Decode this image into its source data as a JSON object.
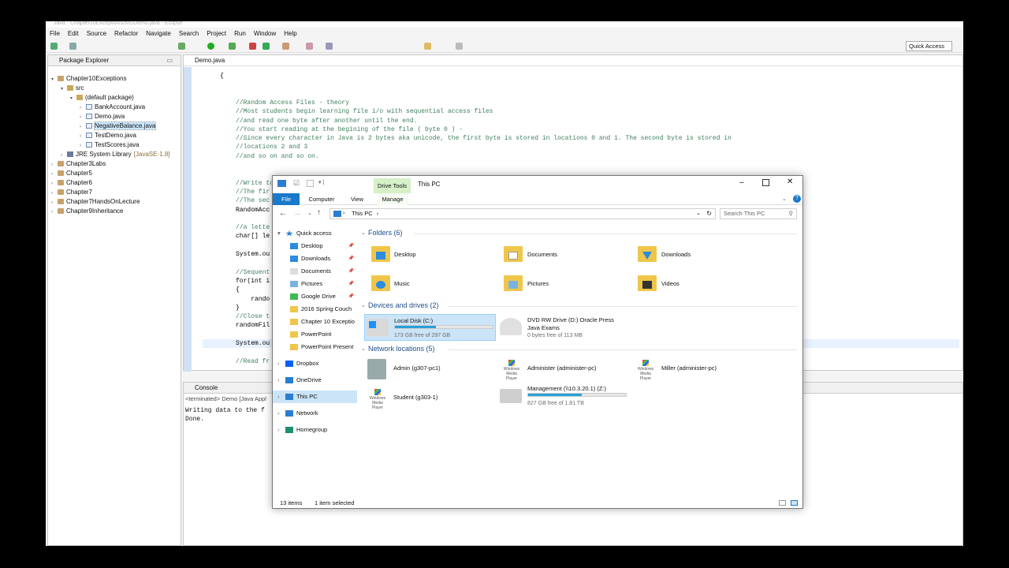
{
  "eclipse": {
    "title": "Java - Chapter10Exceptions/src/Demo.java - Eclipse",
    "menu": [
      "File",
      "Edit",
      "Source",
      "Refactor",
      "Navigate",
      "Search",
      "Project",
      "Run",
      "Window",
      "Help"
    ],
    "quick_access": "Quick Access",
    "package_explorer": {
      "tab": "Package Explorer",
      "items": [
        {
          "label": "Chapter10Exceptions",
          "level": 0,
          "icon": "project-icon",
          "twisty": "▾"
        },
        {
          "label": "src",
          "level": 1,
          "icon": "package-folder-icon",
          "twisty": "▾"
        },
        {
          "label": "(default package)",
          "level": 2,
          "icon": "package-icon",
          "twisty": "▾"
        },
        {
          "label": "BankAccount.java",
          "level": 3,
          "icon": "java-file-icon",
          "twisty": "›"
        },
        {
          "label": "Demo.java",
          "level": 3,
          "icon": "java-file-icon",
          "twisty": "›"
        },
        {
          "label": "NegativeBalance.java",
          "level": 3,
          "icon": "java-file-icon",
          "twisty": "›",
          "selected": true
        },
        {
          "label": "TestDemo.java",
          "level": 3,
          "icon": "java-file-icon",
          "twisty": "›"
        },
        {
          "label": "TestScores.java",
          "level": 3,
          "icon": "java-file-icon",
          "twisty": "›"
        },
        {
          "label": "JRE System Library",
          "extra": "[JavaSE-1.8]",
          "level": 1,
          "icon": "library-icon",
          "twisty": "›"
        },
        {
          "label": "Chapter3Labs",
          "level": 0,
          "icon": "project-icon",
          "twisty": "›"
        },
        {
          "label": "Chapter5",
          "level": 0,
          "icon": "project-icon",
          "twisty": "›"
        },
        {
          "label": "Chapter6",
          "level": 0,
          "icon": "project-icon",
          "twisty": "›"
        },
        {
          "label": "Chapter7",
          "level": 0,
          "icon": "project-icon",
          "twisty": "›"
        },
        {
          "label": "Chapter7HandsOnLecture",
          "level": 0,
          "icon": "project-icon",
          "twisty": "›"
        },
        {
          "label": "Chapter9Inheritance",
          "level": 0,
          "icon": "project-icon",
          "twisty": "›"
        }
      ]
    },
    "editor": {
      "tab": "Demo.java",
      "lines": [
        {
          "text": "{",
          "kind": "plain",
          "indent": 0
        },
        {
          "text": "",
          "kind": "plain",
          "indent": 0
        },
        {
          "text": "",
          "kind": "plain",
          "indent": 0
        },
        {
          "text": "//Random Access Files - theory",
          "kind": "cmt",
          "indent": 1
        },
        {
          "text": "//Most students begin learning file i/o with sequential access files",
          "kind": "cmt",
          "indent": 1
        },
        {
          "text": "//and read one byte after another until the end.",
          "kind": "cmt",
          "indent": 1
        },
        {
          "text": "//You start reading at the begining of the file ( byte 0 ) -",
          "kind": "cmt",
          "indent": 1
        },
        {
          "text": "//Since every character in Java is 2 bytes aka unicode, the first byte is stored in locations 0 and 1. The second byte is stored in",
          "kind": "cmt",
          "indent": 1
        },
        {
          "text": "//locations 2 and 3",
          "kind": "cmt",
          "indent": 1
        },
        {
          "text": "//and so on and so on.",
          "kind": "cmt",
          "indent": 1
        },
        {
          "text": "",
          "kind": "plain",
          "indent": 0
        },
        {
          "text": "",
          "kind": "plain",
          "indent": 0
        },
        {
          "text": "//Write to the Random Access File",
          "kind": "cmt",
          "indent": 1
        },
        {
          "text": "//The fir",
          "kind": "cmt",
          "indent": 1
        },
        {
          "text": "//The sec",
          "kind": "cmt",
          "indent": 1
        },
        {
          "text": "RandomAcc",
          "kind": "plain",
          "indent": 1
        },
        {
          "text": "",
          "kind": "plain",
          "indent": 0
        },
        {
          "text": "//a lette",
          "kind": "cmt",
          "indent": 1
        },
        {
          "text": "char[] le",
          "kind": "plain",
          "indent": 1
        },
        {
          "text": "",
          "kind": "plain",
          "indent": 0
        },
        {
          "text": "System.ou",
          "kind": "plain",
          "indent": 1
        },
        {
          "text": "",
          "kind": "plain",
          "indent": 0
        },
        {
          "text": "//Sequent",
          "kind": "cmt",
          "indent": 1
        },
        {
          "text": "for(int i",
          "kind": "plain",
          "indent": 1
        },
        {
          "text": "{",
          "kind": "plain",
          "indent": 1
        },
        {
          "text": "    rando",
          "kind": "plain",
          "indent": 1
        },
        {
          "text": "}",
          "kind": "plain",
          "indent": 1
        },
        {
          "text": "//Close t",
          "kind": "cmt",
          "indent": 1
        },
        {
          "text": "randomFil",
          "kind": "plain",
          "indent": 1
        },
        {
          "text": "",
          "kind": "plain",
          "indent": 0
        },
        {
          "text": "System.ou",
          "kind": "plain",
          "indent": 1,
          "highlight": true
        },
        {
          "text": "",
          "kind": "plain",
          "indent": 0
        },
        {
          "text": "//Read fr",
          "kind": "cmt",
          "indent": 1
        }
      ]
    },
    "console": {
      "tab": "Console",
      "status": "<terminated> Demo [Java Appl",
      "output": [
        "Writing data to the f",
        "Done."
      ]
    }
  },
  "explorer": {
    "title": "This PC",
    "contextual_tab": "Drive Tools",
    "ribbon_tabs": [
      "File",
      "Computer",
      "View",
      "Manage"
    ],
    "address": "This PC",
    "search_placeholder": "Search This PC",
    "nav": [
      {
        "label": "Quick access",
        "icon": "star-icon",
        "level": 0,
        "twisty": "▾"
      },
      {
        "label": "Desktop",
        "icon": "desktop-icon",
        "level": 1,
        "pinned": true
      },
      {
        "label": "Downloads",
        "icon": "downloads-icon",
        "level": 1,
        "pinned": true
      },
      {
        "label": "Documents",
        "icon": "documents-icon",
        "level": 1,
        "pinned": true
      },
      {
        "label": "Pictures",
        "icon": "pictures-icon",
        "level": 1,
        "pinned": true
      },
      {
        "label": "Google Drive",
        "icon": "google-drive-icon",
        "level": 1,
        "pinned": true
      },
      {
        "label": "2016 Spring Couch",
        "icon": "folder-icon",
        "level": 1
      },
      {
        "label": "Chapter 10 Exceptio",
        "icon": "folder-icon",
        "level": 1
      },
      {
        "label": "PowerPoint",
        "icon": "folder-icon",
        "level": 1
      },
      {
        "label": "PowerPoint Present",
        "icon": "folder-icon",
        "level": 1
      },
      {
        "label": "Dropbox",
        "icon": "dropbox-icon",
        "level": 0,
        "twisty": "›"
      },
      {
        "label": "OneDrive",
        "icon": "onedrive-icon",
        "level": 0,
        "twisty": "›"
      },
      {
        "label": "This PC",
        "icon": "this-pc-icon",
        "level": 0,
        "twisty": "›",
        "selected": true
      },
      {
        "label": "Network",
        "icon": "network-icon",
        "level": 0,
        "twisty": "›"
      },
      {
        "label": "Homegroup",
        "icon": "homegroup-icon",
        "level": 0,
        "twisty": "›"
      }
    ],
    "folders_header": "Folders (6)",
    "folders": [
      "Desktop",
      "Documents",
      "Downloads",
      "Music",
      "Pictures",
      "Videos"
    ],
    "devices_header": "Devices and drives (2)",
    "drives": [
      {
        "name": "Local Disk (C:)",
        "free": "173 GB free of 297 GB",
        "used_fraction": 0.42,
        "selected": true
      },
      {
        "name": "DVD RW Drive (D:) Oracle Press",
        "name2": "Java Exams",
        "free": "0 bytes free of 113 MB"
      }
    ],
    "network_header": "Network locations (5)",
    "network": [
      {
        "name": "Admin (g307-pc1)"
      },
      {
        "name": "Administer (administer-pc)",
        "tile_text": "Windows Media Player"
      },
      {
        "name": "Miller (administer-pc)",
        "tile_text": "Windows Media Player"
      },
      {
        "name": "Student (g303-1)",
        "tile_text": "Windows Media Player"
      },
      {
        "name": "Management (\\\\10.3.20.1) (Z:)",
        "free": "827 GB free of 1.81 TB",
        "used_fraction": 0.55
      }
    ],
    "status": {
      "items": "13 items",
      "selected": "1 item selected"
    },
    "colors": {
      "accent": "#1979ca",
      "drive_bar": "#26a0da",
      "selection": "#cce4f7",
      "folder": "#f0c64a",
      "contextual": "#d6f0c8"
    }
  }
}
